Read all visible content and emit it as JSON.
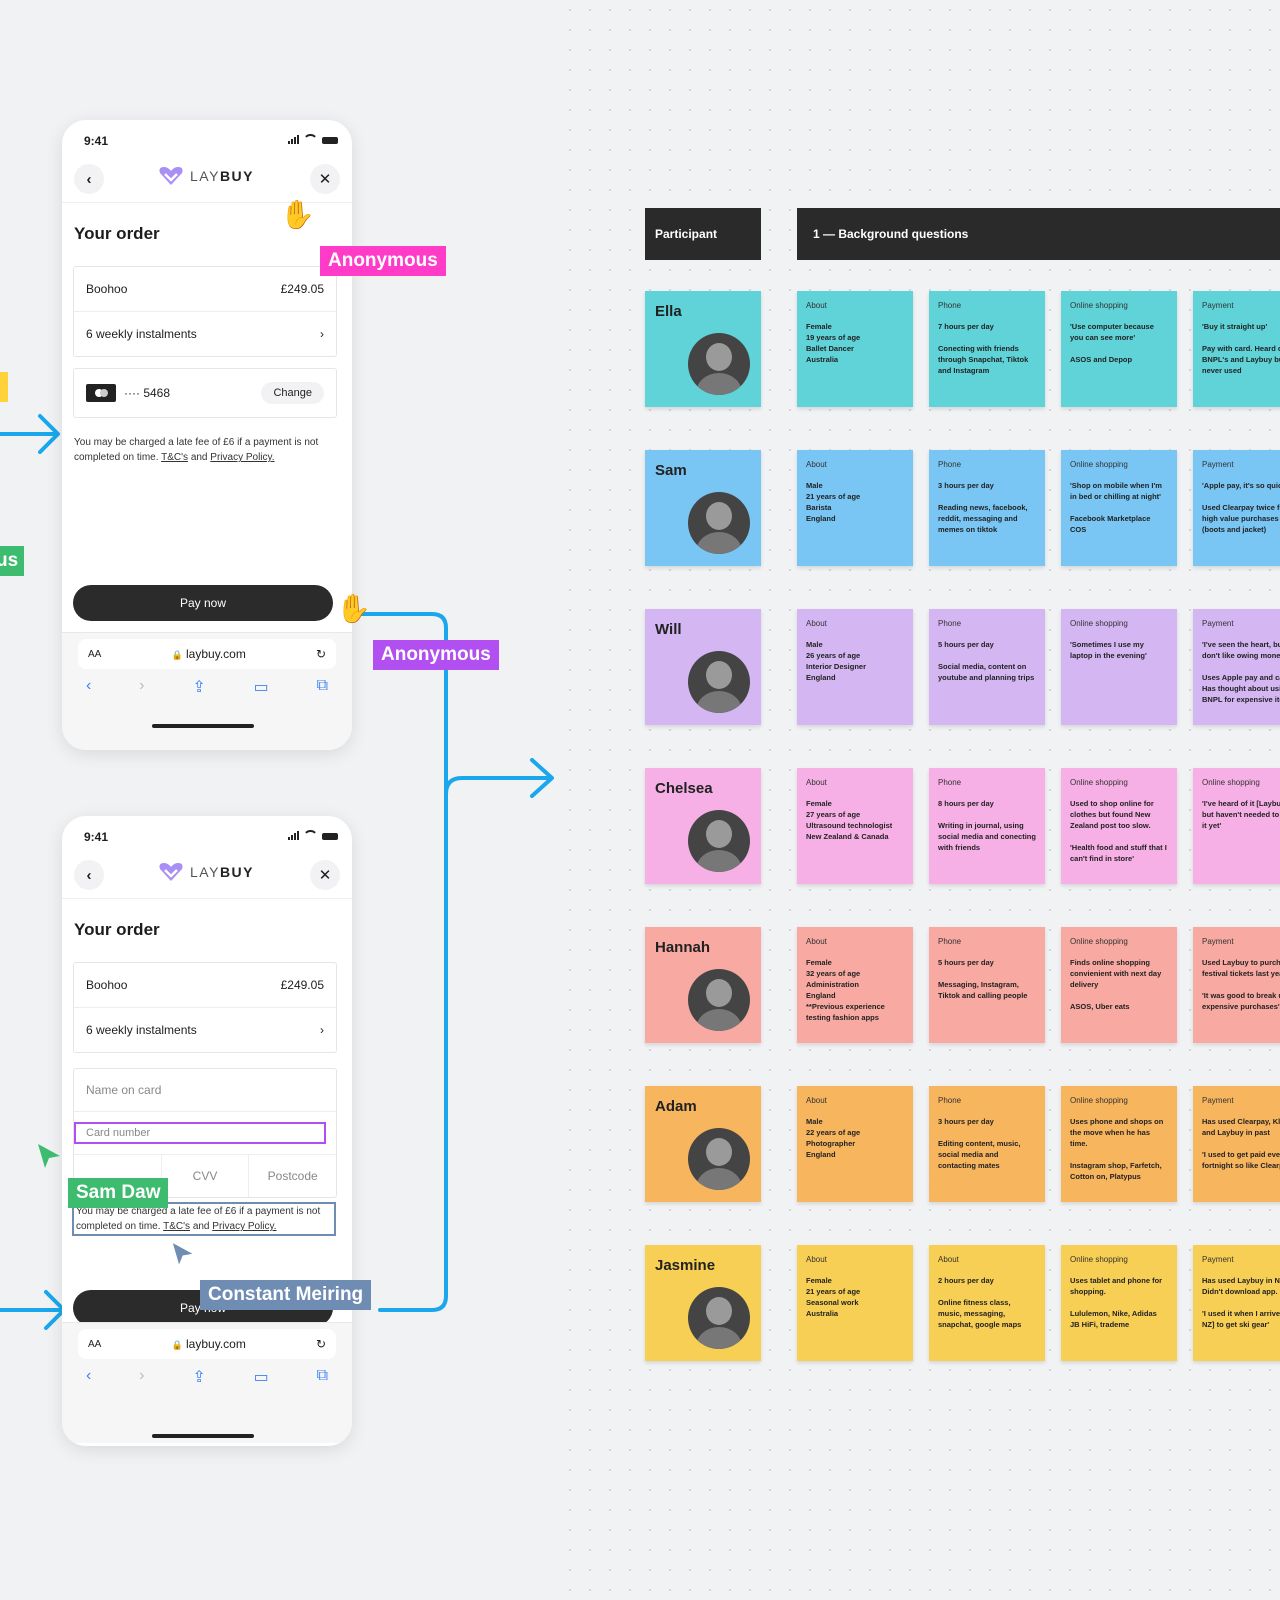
{
  "phone_top": {
    "time": "9:41",
    "logo": {
      "light": "LAY",
      "bold": "BUY"
    },
    "title": "Your order",
    "merchant": "Boohoo",
    "amount": "£249.05",
    "instalments": "6 weekly instalments",
    "card_mask": "···· 5468",
    "change_label": "Change",
    "note_pre": "You may be charged a late fee of £6 if a payment is not completed on time.",
    "note_tc": "T&C's",
    "note_and": "and",
    "note_privacy": "Privacy Policy.",
    "pay_label": "Pay now",
    "url_aa": "AA",
    "url": "laybuy.com"
  },
  "phone_bottom": {
    "time": "9:41",
    "logo": {
      "light": "LAY",
      "bold": "BUY"
    },
    "title": "Your order",
    "merchant": "Boohoo",
    "amount": "£249.05",
    "instalments": "6 weekly instalments",
    "name_placeholder": "Name on card",
    "card_placeholder": "Card number",
    "cvv_placeholder": "CVV",
    "postcode_placeholder": "Postcode",
    "note_pre": "You may be charged a late fee of £6 if a payment is not completed on time.",
    "note_tc": "T&C's",
    "note_and": "and",
    "note_privacy": "Privacy Policy.",
    "pay_label": "Pay now",
    "url_aa": "AA",
    "url": "laybuy.com"
  },
  "collaborators": [
    {
      "name": "Anonymous",
      "color": "#ff3cc7"
    },
    {
      "name": "Anonymous",
      "color": "#b14ff0"
    },
    {
      "name": "Sam Daw",
      "color": "#3dbb6f"
    },
    {
      "name": "Constant Meiring",
      "color": "#6f8db3"
    }
  ],
  "edge_tags": {
    "left_green": "us"
  },
  "board": {
    "participant_header": "Participant",
    "questions_header": "1 — Background questions",
    "rows": [
      {
        "name": "Ella",
        "color": "#5fd3d8",
        "notes": [
          {
            "label": "About",
            "text": "Female\n19 years of age\nBallet Dancer\nAustralia"
          },
          {
            "label": "Phone",
            "text": "7 hours per day\n\nConecting with friends through Snapchat, Tiktok and Instagram"
          },
          {
            "label": "Online shopping",
            "text": "'Use computer because you can see more'\n\nASOS and Depop"
          },
          {
            "label": "Payment",
            "text": "'Buy it straight up'\n\nPay with card. Heard of BNPL's and Laybuy but never used"
          }
        ]
      },
      {
        "name": "Sam",
        "color": "#79c6f4",
        "notes": [
          {
            "label": "About",
            "text": "Male\n21 years of age\nBarista\nEngland"
          },
          {
            "label": "Phone",
            "text": "3 hours per day\n\nReading news, facebook, reddit, messaging and memes on tiktok"
          },
          {
            "label": "Online shopping",
            "text": "'Shop on mobile when I'm in bed or chilling at night'\n\nFacebook Marketplace\nCOS"
          },
          {
            "label": "Payment",
            "text": "'Apple pay, it's so quick'\n\nUsed Clearpay twice for high value purchases (boots and jacket)"
          }
        ]
      },
      {
        "name": "Will",
        "color": "#d4b6f3",
        "notes": [
          {
            "label": "About",
            "text": "Male\n26 years of age\nInterior Designer\nEngland"
          },
          {
            "label": "Phone",
            "text": "5 hours per day\n\nSocial media, content on youtube and planning trips"
          },
          {
            "label": "Online shopping",
            "text": "'Sometimes I use my laptop in the evening'"
          },
          {
            "label": "Payment",
            "text": "'I've seen the heart, but don't like owing money'\n\nUses Apple pay and card. Has thought about using BNPL for expensive items"
          }
        ]
      },
      {
        "name": "Chelsea",
        "color": "#f7b0e6",
        "notes": [
          {
            "label": "About",
            "text": "Female\n27 years of age\nUltrasound technologist\nNew Zealand & Canada"
          },
          {
            "label": "Phone",
            "text": "8 hours per day\n\nWriting in journal, using social media and conecting with friends"
          },
          {
            "label": "Online shopping",
            "text": "Used to shop online for clothes but found New Zealand post too slow.\n\n'Health food and stuff that I can't find in store'"
          },
          {
            "label": "Online shopping",
            "text": "'I've heard of it [Laybuy] but haven't needed to use it yet'"
          }
        ]
      },
      {
        "name": "Hannah",
        "color": "#f8a9a1",
        "notes": [
          {
            "label": "About",
            "text": "Female\n32 years of age\nAdministration\nEngland\n**Previous experience testing fashion apps"
          },
          {
            "label": "Phone",
            "text": "5 hours per day\n\nMessaging, Instagram, Tiktok and calling people"
          },
          {
            "label": "Online shopping",
            "text": "Finds online shopping convienient with next day delivery\n\nASOS, Uber eats"
          },
          {
            "label": "Payment",
            "text": "Used Laybuy to purchase festival tickets last year\n\n'It was good to break up expensive purchases'"
          }
        ]
      },
      {
        "name": "Adam",
        "color": "#f7b55e",
        "notes": [
          {
            "label": "About",
            "text": "Male\n22 years of age\nPhotographer\nEngland"
          },
          {
            "label": "Phone",
            "text": "3 hours per day\n\nEditing content, music, social media and contacting mates"
          },
          {
            "label": "Online shopping",
            "text": "Uses phone and shops on the move when he has time.\n\nInstagram shop, Farfetch, Cotton on, Platypus"
          },
          {
            "label": "Payment",
            "text": "Has used Clearpay, Klarna and Laybuy in past\n\n'I used to get paid every fortnight so like Clearpay'"
          }
        ]
      },
      {
        "name": "Jasmine",
        "color": "#f7cf55",
        "notes": [
          {
            "label": "About",
            "text": "Female\n21 years of age\nSeasonal work\nAustralia"
          },
          {
            "label": "About",
            "text": "2 hours per day\n\nOnline fitness class, music, messaging, snapchat, google maps"
          },
          {
            "label": "Online shopping",
            "text": "Uses tablet and phone for shopping.\n\nLululemon, Nike, Adidas JB HiFi, trademe"
          },
          {
            "label": "Payment",
            "text": "Has used Laybuy in NZ. Didn't download app.\n\n'I used it when I arrived in NZ] to get ski gear'"
          }
        ]
      }
    ]
  }
}
